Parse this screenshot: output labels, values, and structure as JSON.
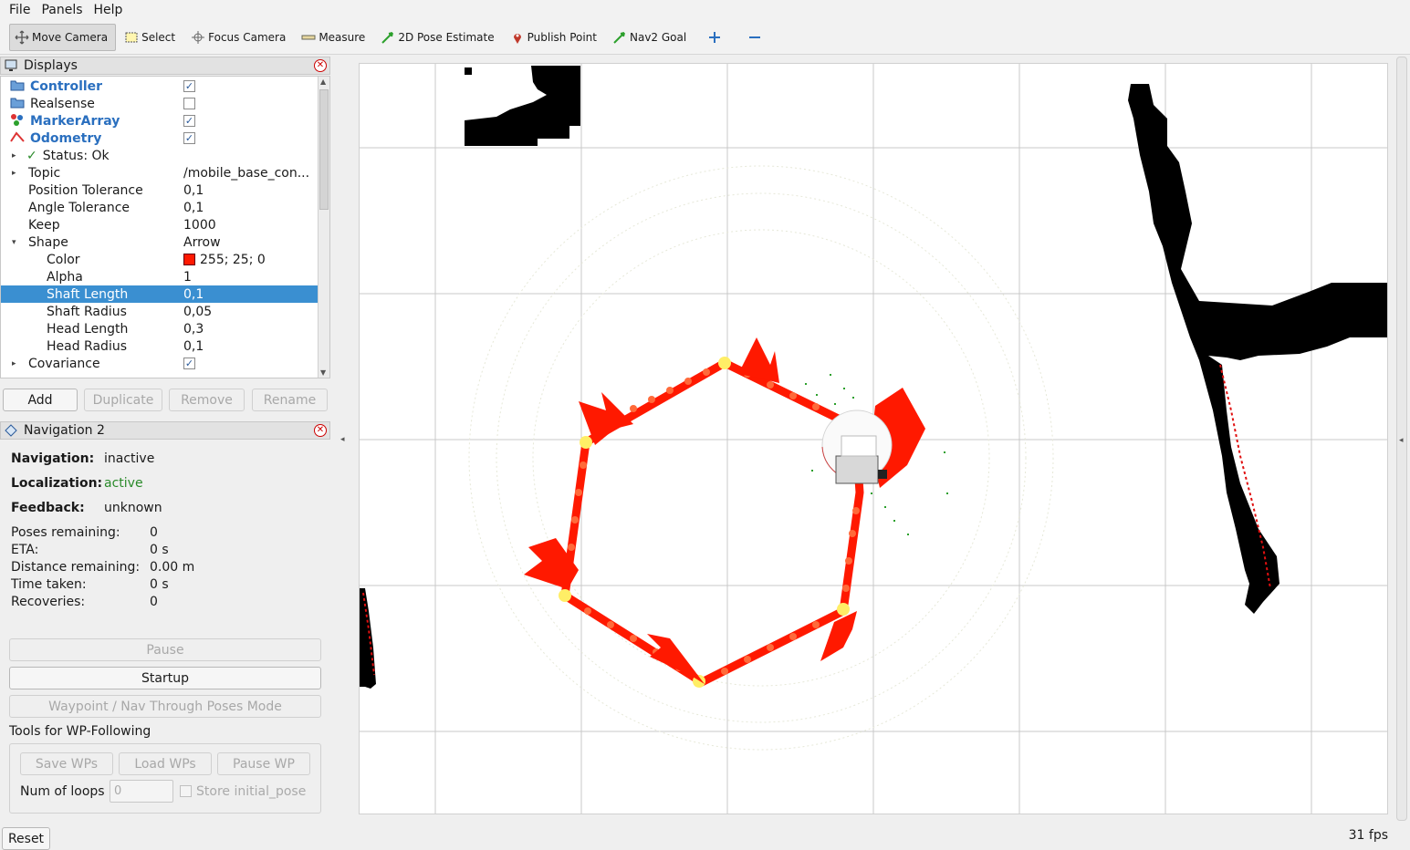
{
  "menu": {
    "file": "File",
    "panels": "Panels",
    "help": "Help"
  },
  "toolbar": {
    "move_camera": "Move Camera",
    "select": "Select",
    "focus_camera": "Focus Camera",
    "measure": "Measure",
    "pose_estimate": "2D Pose Estimate",
    "publish_point": "Publish Point",
    "nav2_goal": "Nav2 Goal"
  },
  "displays": {
    "title": "Displays",
    "rows": [
      {
        "label": "Controller",
        "checked": "✓"
      },
      {
        "label": "Realsense",
        "checked": ""
      },
      {
        "label": "MarkerArray",
        "checked": "✓"
      },
      {
        "label": "Odometry",
        "checked": "✓"
      },
      {
        "label": "Status: Ok",
        "value": ""
      },
      {
        "label": "Topic",
        "value": "/mobile_base_con..."
      },
      {
        "label": "Position Tolerance",
        "value": "0,1"
      },
      {
        "label": "Angle Tolerance",
        "value": "0,1"
      },
      {
        "label": "Keep",
        "value": "1000"
      },
      {
        "label": "Shape",
        "value": "Arrow"
      },
      {
        "label": "Color",
        "value": "255; 25; 0"
      },
      {
        "label": "Alpha",
        "value": "1"
      },
      {
        "label": "Shaft Length",
        "value": "0,1"
      },
      {
        "label": "Shaft Radius",
        "value": "0,05"
      },
      {
        "label": "Head Length",
        "value": "0,3"
      },
      {
        "label": "Head Radius",
        "value": "0,1"
      },
      {
        "label": "Covariance",
        "checked": "✓"
      }
    ],
    "color_swatch": "#ff1900",
    "buttons": {
      "add": "Add",
      "duplicate": "Duplicate",
      "remove": "Remove",
      "rename": "Rename"
    }
  },
  "navigation": {
    "title": "Navigation 2",
    "navigation_label": "Navigation:",
    "navigation_value": "inactive",
    "localization_label": "Localization:",
    "localization_value": "active",
    "feedback_label": "Feedback:",
    "feedback_value": "unknown",
    "poses_label": "Poses remaining:",
    "poses_value": "0",
    "eta_label": "ETA:",
    "eta_value": "0 s",
    "distance_label": "Distance remaining:",
    "distance_value": "0.00 m",
    "time_label": "Time taken:",
    "time_value": "0 s",
    "recoveries_label": "Recoveries:",
    "recoveries_value": "0",
    "pause": "Pause",
    "startup": "Startup",
    "waypoint_mode": "Waypoint / Nav Through Poses Mode",
    "tools_label": "Tools for WP-Following",
    "save_wps": "Save WPs",
    "load_wps": "Load WPs",
    "pause_wp": "Pause WP",
    "loops_label": "Num of loops",
    "loops_value": "0",
    "store_initial": "Store initial_pose"
  },
  "status": {
    "reset": "Reset",
    "fps": "31 fps"
  },
  "colors": {
    "selection": "#3a8fd1",
    "path": "#ff1900",
    "waypoint": "#ffee66"
  }
}
